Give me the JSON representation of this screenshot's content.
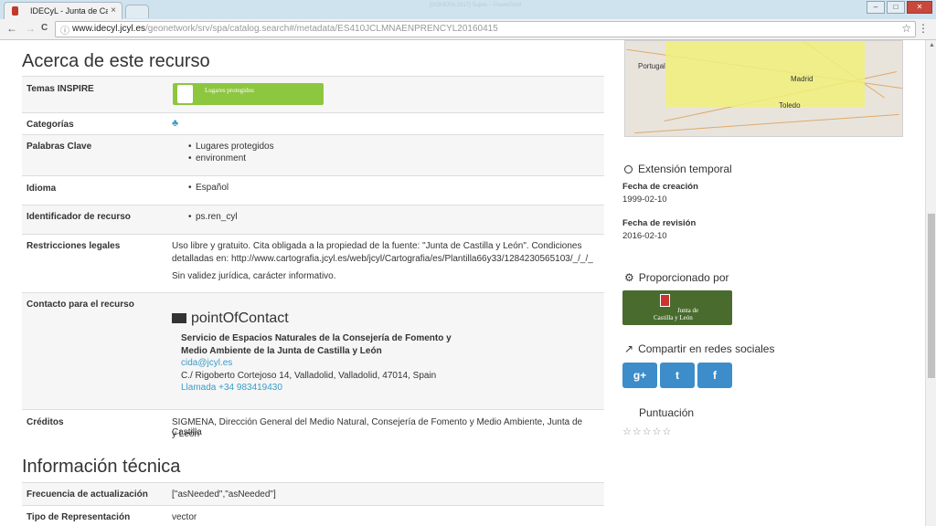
{
  "browser": {
    "tab_title": "IDECyL - Junta de Castilla",
    "tab_close": "×",
    "ghost_title": "[GOMERA 2017] Sujeto – PowerPoint",
    "url_host": "www.idecyl.jcyl.es",
    "url_path": "/geonetwork/srv/spa/catalog.search#/metadata/ES410JCLMNAENPRENCYL20160415",
    "win_min": "–",
    "win_max": "□",
    "win_close": "✕",
    "back": "←",
    "forward": "→",
    "reload": "C",
    "info": "ⓘ",
    "star": "☆",
    "menu": "⋮"
  },
  "resource": {
    "heading": "Acerca de este recurso",
    "inspire": {
      "label": "Temas INSPIRE",
      "badge": "Lugares protegidos"
    },
    "categories": {
      "label": "Categorías",
      "icon": "tree-icon"
    },
    "keywords": {
      "label": "Palabras Clave",
      "items": [
        "Lugares protegidos",
        "environment"
      ]
    },
    "language": {
      "label": "Idioma",
      "value": "Español"
    },
    "identifier": {
      "label": "Identificador de recurso",
      "value": "ps.ren_cyl"
    },
    "legal": {
      "label": "Restricciones legales",
      "line1": "Uso libre y gratuito. Cita obligada a la propiedad de la fuente: \"Junta de Castilla y León\". Condiciones",
      "line2": "detalladas en: http://www.cartografia.jcyl.es/web/jcyl/Cartografia/es/Plantilla66y33/1284230565103/_/_/_",
      "line3": "Sin validez jurídica, carácter informativo."
    },
    "contact": {
      "label": "Contacto para el recurso",
      "role": "pointOfContact",
      "org_line1": "Servicio de Espacios Naturales de la Consejería de Fomento y",
      "org_line2": "Medio Ambiente de la Junta de Castilla y León",
      "email": "cida@jcyl.es",
      "address": "C./ Rigoberto Cortejoso 14, Valladolid, Valladolid, 47014, Spain",
      "phone": "Llamada +34 983419430"
    },
    "credits": {
      "label": "Créditos",
      "line1": "SIGMENA, Dirección General del Medio Natural, Consejería de Fomento y Medio Ambiente, Junta de Castilla",
      "line2": "y León"
    }
  },
  "technical": {
    "heading": "Información técnica",
    "frequency": {
      "label": "Frecuencia de actualización",
      "value": "[\"asNeeded\",\"asNeeded\"]"
    },
    "representation": {
      "label": "Tipo de Representación",
      "value": "vector"
    }
  },
  "sidebar": {
    "map": {
      "portugal": "Portugal",
      "madrid": "Madrid",
      "toledo": "Toledo"
    },
    "temporal": {
      "heading": "Extensión temporal",
      "created_label": "Fecha de creación",
      "created": "1999-02-10",
      "revised_label": "Fecha de revisión",
      "revised": "2016-02-10"
    },
    "provider": {
      "heading": "Proporcionado por",
      "logo_line1": "Junta de",
      "logo_line2": "Castilla y León"
    },
    "share": {
      "heading": "Compartir en redes sociales",
      "google": "g+",
      "twitter": "t",
      "facebook": "f"
    },
    "rating": {
      "heading": "Puntuación",
      "stars": "☆☆☆☆☆"
    }
  }
}
